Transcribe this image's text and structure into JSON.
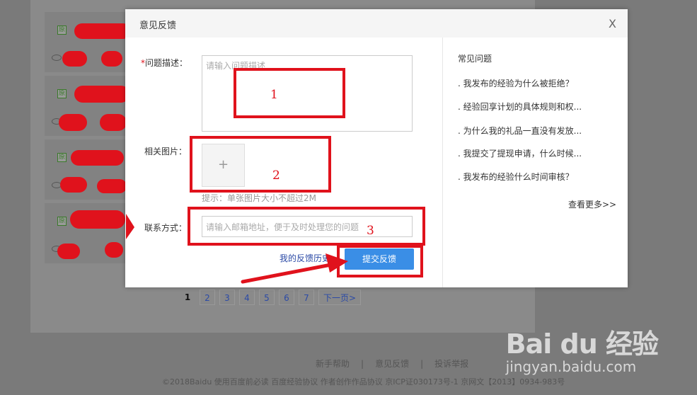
{
  "background_page": {
    "list_rows": [
      {
        "tag": "原"
      },
      {
        "tag": "原"
      },
      {
        "tag": "原"
      },
      {
        "tag": "原"
      }
    ],
    "pagination": {
      "pages": [
        "1",
        "2",
        "3",
        "4",
        "5",
        "6",
        "7"
      ],
      "current": "1",
      "next_label": "下一页>"
    },
    "footer": {
      "links": [
        "新手帮助",
        "意见反馈",
        "投诉举报"
      ],
      "separator": "|",
      "copyright": "©2018Baidu  使用百度前必读  百度经验协议  作者创作作品协议  京ICP证030173号-1 京网文【2013】0934-983号"
    },
    "watermark": {
      "logo": "Bai du 经验",
      "url": "jingyan.baidu.com"
    }
  },
  "dialog": {
    "title": "意见反馈",
    "close_label": "X",
    "form": {
      "description": {
        "required_mark": "*",
        "label": "问题描述：",
        "placeholder": "请输入问题描述"
      },
      "images": {
        "label": "相关图片：",
        "upload_symbol": "+",
        "hint": "提示：单张图片大小不超过2M"
      },
      "contact": {
        "label": "联系方式：",
        "placeholder": "请输入邮箱地址，便于及时处理您的问题"
      },
      "history_link": "我的反馈历史",
      "submit_label": "提交反馈"
    },
    "faq": {
      "title": "常见问题",
      "items": [
        ". 我发布的经验为什么被拒绝？",
        ". 经验回享计划的具体规则和权...",
        ". 为什么我的礼品一直没有发放...",
        ". 我提交了提现申请，什么时候...",
        ". 我发布的经验什么时间审核？"
      ],
      "more_label": "查看更多>>"
    }
  },
  "annotations": {
    "numbers": [
      "1",
      "2",
      "3"
    ],
    "color": "#e0121c"
  },
  "colors": {
    "accent_button": "#3a8ee6",
    "link": "#2b4aa6",
    "annotation_red": "#e0121c",
    "required_red": "#e0121c"
  }
}
